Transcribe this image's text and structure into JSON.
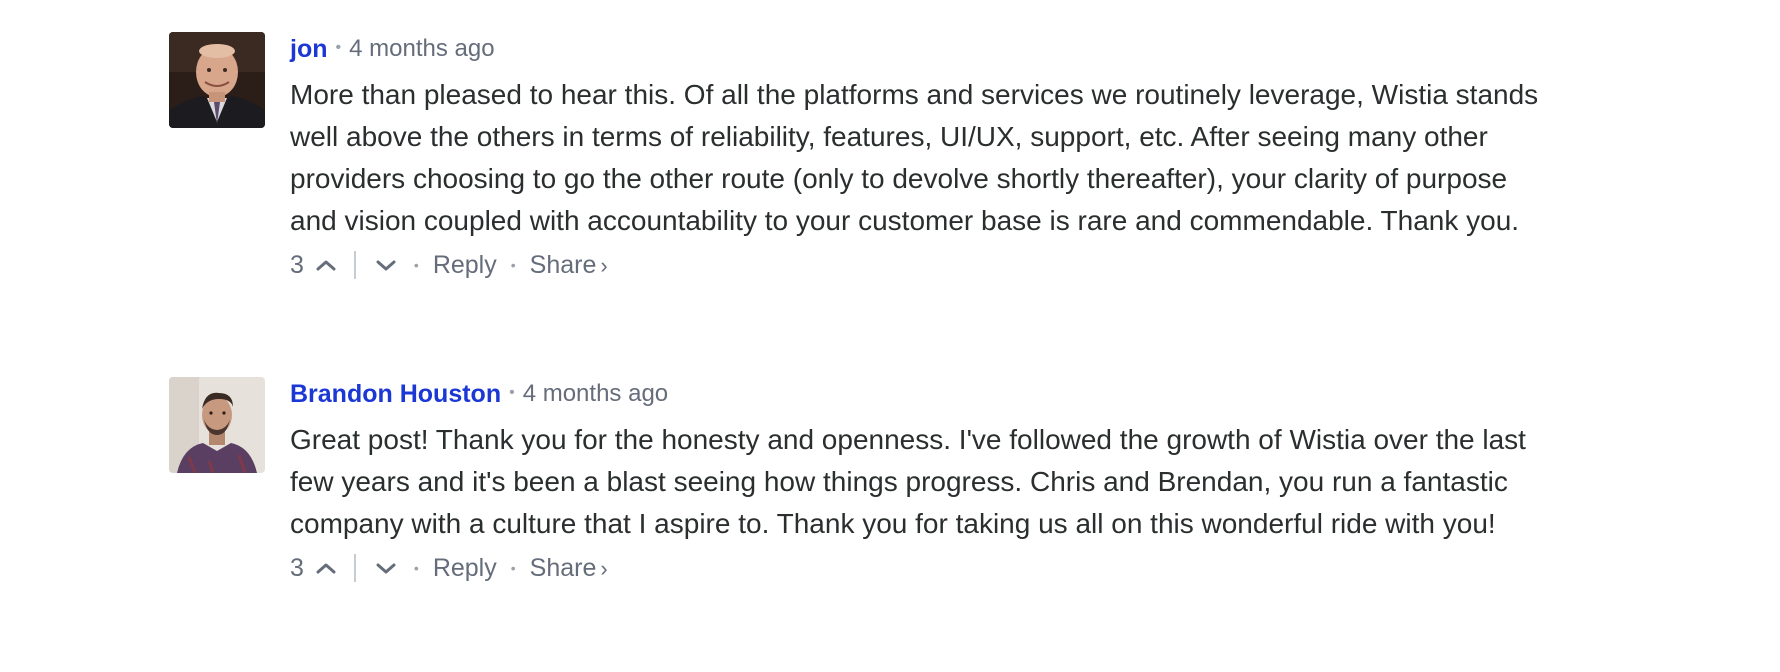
{
  "comments": [
    {
      "author": "jon",
      "time": "4 months ago",
      "text": "More than pleased to hear this. Of all the platforms and services we routinely leverage, Wistia stands well above the others in terms of reliability, features, UI/UX, support, etc. After seeing many other providers choosing to go the other route (only to devolve shortly thereafter), your clarity of purpose and vision coupled with accountability to your customer base is rare and commendable. Thank you.",
      "votes": "3",
      "reply_label": "Reply",
      "share_label": "Share",
      "share_arrow": "›"
    },
    {
      "author": "Brandon Houston",
      "time": "4 months ago",
      "text": "Great post! Thank you for the honesty and openness. I've followed the growth of Wistia over the last few years and it's been a blast seeing how things progress. Chris and Brendan, you run a fantastic company with a culture that I aspire to. Thank you for taking us all on this wonderful ride with you!",
      "votes": "3",
      "reply_label": "Reply",
      "share_label": "Share",
      "share_arrow": "›"
    }
  ],
  "separators": {
    "meta_dot": "•",
    "action_dot": "•"
  },
  "icons": {
    "upvote": "chevron-up-icon",
    "downvote": "chevron-down-icon",
    "avatar": "avatar-photo"
  },
  "colors": {
    "author_link": "#1b37d4",
    "muted_text": "#656c7a",
    "body_text": "#2a2e2e"
  }
}
